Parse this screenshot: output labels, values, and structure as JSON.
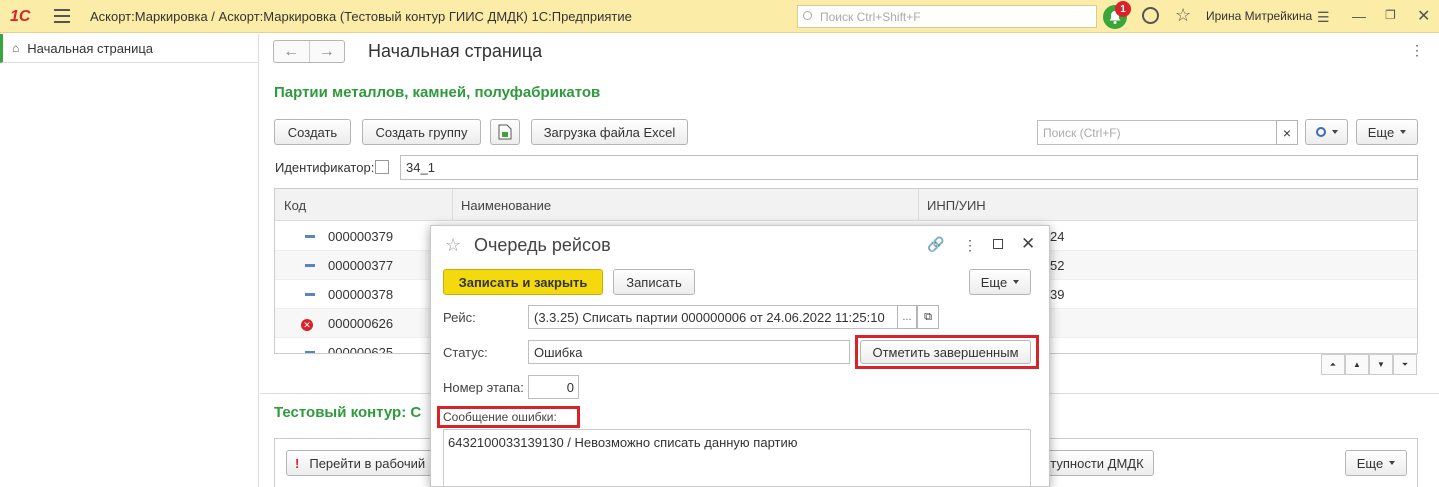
{
  "topbar": {
    "logo": "1С",
    "title": "Аскорт:Маркировка / Аскорт:Маркировка (Тестовый контур ГИИС ДМДК) 1С:Предприятие",
    "search_placeholder": "Поиск Ctrl+Shift+F",
    "notifications_count": "1",
    "user_name": "Ирина Митрейкина"
  },
  "sidebar": {
    "items": [
      {
        "label": "Начальная страница"
      }
    ]
  },
  "page": {
    "title": "Начальная страница"
  },
  "section1": {
    "title": "Партии металлов, камней, полуфабрикатов",
    "toolbar": {
      "create_label": "Создать",
      "create_group_label": "Создать группу",
      "load_excel_label": "Загрузка файла Excel",
      "search_placeholder": "Поиск (Ctrl+F)",
      "clear_label": "×",
      "more_label": "Еще"
    },
    "filter": {
      "label": "Идентификатор:",
      "value": "34_1"
    },
    "table": {
      "columns": [
        "Код",
        "Наименование",
        "ИНП/УИН"
      ],
      "rows": [
        {
          "code": "000000379",
          "inn": "24",
          "status": "normal"
        },
        {
          "code": "000000377",
          "inn": "52",
          "status": "normal"
        },
        {
          "code": "000000378",
          "inn": "39",
          "status": "normal"
        },
        {
          "code": "000000626",
          "inn": "",
          "status": "error"
        },
        {
          "code": "000000625",
          "inn": "",
          "status": "normal"
        }
      ]
    }
  },
  "section2": {
    "title": "Тестовый контур: С",
    "goto_label": "Перейти в рабочий",
    "dmdk_label": "тупности ДМДК",
    "more_label": "Еще"
  },
  "dialog": {
    "title": "Очередь рейсов",
    "save_close_label": "Записать и закрыть",
    "save_label": "Записать",
    "more_label": "Еще",
    "reys_label": "Рейс:",
    "reys_value": "(3.3.25) Списать партии 000000006 от 24.06.2022 11:25:10",
    "reys_select_label": "...",
    "status_label": "Статус:",
    "status_value": "Ошибка",
    "mark_done_label": "Отметить завершенным",
    "stage_label": "Номер этапа:",
    "stage_value": "0",
    "error_label": "Сообщение ошибки:",
    "error_text": "6432100033139130 / Невозможно списать данную партию"
  },
  "colors": {
    "topbar": "#fbeda7",
    "accent_green": "#2f9a3c",
    "primary_button": "#f5d90f",
    "highlight_red": "#d9232a"
  }
}
